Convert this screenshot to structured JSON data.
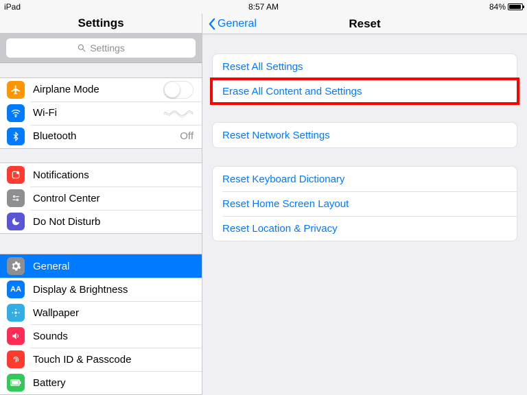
{
  "status": {
    "device": "iPad",
    "time": "8:57 AM",
    "battery": "84%"
  },
  "sidebar": {
    "title": "Settings",
    "search_placeholder": "Settings",
    "group1": {
      "airplane": "Airplane Mode",
      "wifi": "Wi-Fi",
      "wifi_value": " ",
      "bluetooth": "Bluetooth",
      "bluetooth_value": "Off"
    },
    "group2": {
      "notifications": "Notifications",
      "control_center": "Control Center",
      "dnd": "Do Not Disturb"
    },
    "group3": {
      "general": "General",
      "display": "Display & Brightness",
      "wallpaper": "Wallpaper",
      "sounds": "Sounds",
      "touchid": "Touch ID & Passcode",
      "battery": "Battery"
    }
  },
  "detail": {
    "back": "General",
    "title": "Reset",
    "g1": {
      "reset_all": "Reset All Settings",
      "erase_all": "Erase All Content and Settings"
    },
    "g2": {
      "reset_network": "Reset Network Settings"
    },
    "g3": {
      "reset_keyboard": "Reset Keyboard Dictionary",
      "reset_home": "Reset Home Screen Layout",
      "reset_location": "Reset Location & Privacy"
    }
  }
}
